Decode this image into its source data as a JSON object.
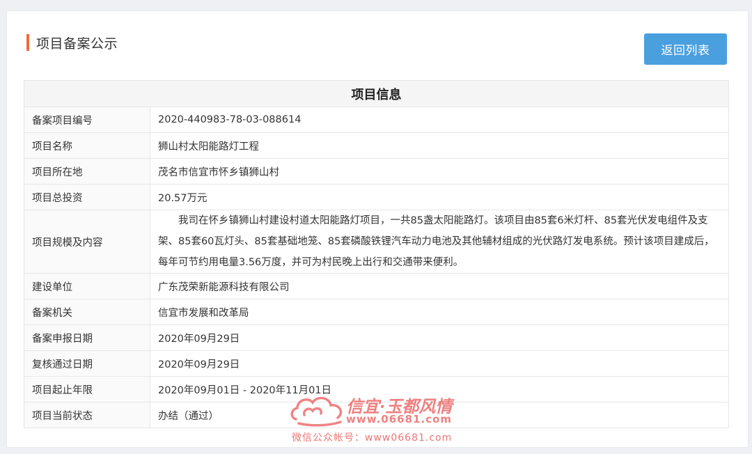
{
  "header": {
    "title": "项目备案公示",
    "back_label": "返回列表"
  },
  "table": {
    "heading": "项目信息",
    "rows": [
      {
        "label": "备案项目编号",
        "value": "2020-440983-78-03-088614"
      },
      {
        "label": "项目名称",
        "value": "狮山村太阳能路灯工程"
      },
      {
        "label": "项目所在地",
        "value": "茂名市信宜市怀乡镇狮山村"
      },
      {
        "label": "项目总投资",
        "value": "20.57万元"
      },
      {
        "label": "项目规模及内容",
        "value": "我司在怀乡镇狮山村建设村道太阳能路灯项目，一共85盏太阳能路灯。该项目由85套6米灯杆、85套光伏发电组件及支架、85套60瓦灯头、85套基础地笼、85套磷酸铁锂汽车动力电池及其他辅材组成的光伏路灯发电系统。预计该项目建成后，每年可节约用电量3.56万度，并可为村民晚上出行和交通带来便利。"
      },
      {
        "label": "建设单位",
        "value": "广东茂荣新能源科技有限公司"
      },
      {
        "label": "备案机关",
        "value": "信宜市发展和改革局"
      },
      {
        "label": "备案申报日期",
        "value": "2020年09月29日"
      },
      {
        "label": "复核通过日期",
        "value": "2020年09月29日"
      },
      {
        "label": "项目起止年限",
        "value": "2020年09月01日 - 2020年11月01日"
      },
      {
        "label": "项目当前状态",
        "value": "办结（通过）"
      }
    ]
  },
  "watermark": {
    "brand": "信宜·玉都风情",
    "url": "www.06681.com",
    "wechat": "微信公众帐号：www06681.com",
    "icon": "cloud-logo-icon",
    "color": "#e85050"
  },
  "colors": {
    "accent_bar": "#f06b3a",
    "button": "#4a9fdf"
  }
}
